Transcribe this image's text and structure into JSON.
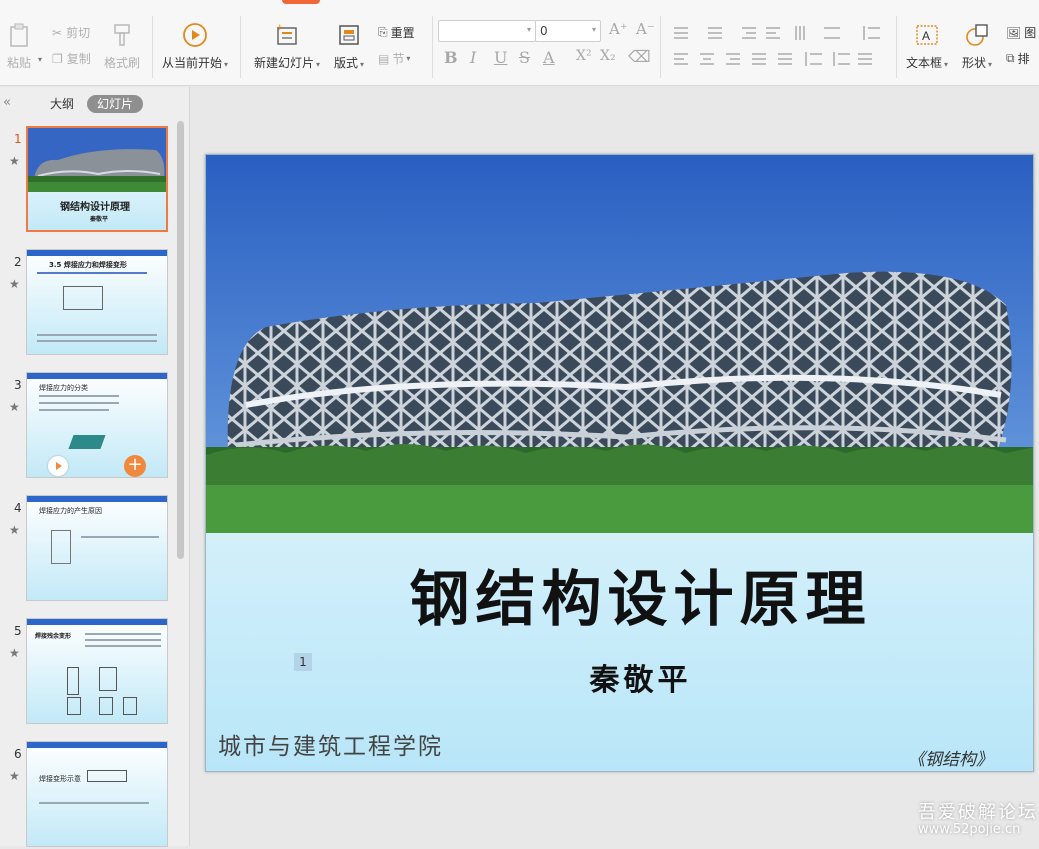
{
  "toolbar": {
    "paste": "粘贴",
    "cut": "剪切",
    "copy": "复制",
    "format_painter": "格式刷",
    "from_start": "从当前开始",
    "new_slide": "新建幻灯片",
    "layout": "版式",
    "section": "节",
    "reset": "重置",
    "font_name_value": "",
    "font_size_value": "0",
    "textbox": "文本框",
    "shape": "形状",
    "picture": "图",
    "arrange": "排"
  },
  "panel": {
    "collapse_glyph": "«",
    "tab_outline": "大纲",
    "tab_slides": "幻灯片"
  },
  "thumbnails": [
    {
      "num": "1",
      "title": "钢结构设计原理",
      "subtitle": "秦敬平"
    },
    {
      "num": "2",
      "title": "3.5 焊接应力和焊接变形"
    },
    {
      "num": "3",
      "title": "焊接应力的分类"
    },
    {
      "num": "4",
      "title": "焊接应力的产生原因"
    },
    {
      "num": "5",
      "title": "焊接残余变形"
    },
    {
      "num": "6",
      "title": "焊接变形示意"
    }
  ],
  "slide": {
    "title": "钢结构设计原理",
    "author": "秦敬平",
    "college": "城市与建筑工程学院",
    "book": "《钢结构》",
    "page_number": "1"
  },
  "watermark": {
    "line1": "吾爱破解论坛",
    "line2": "www.52pojie.cn"
  },
  "colors": {
    "accent_orange": "#f0683a",
    "selected_border": "#f07a43",
    "slide_header_blue": "#2d66c9",
    "sky_blue": "#2f67c8",
    "grass_green": "#3f8a35"
  }
}
